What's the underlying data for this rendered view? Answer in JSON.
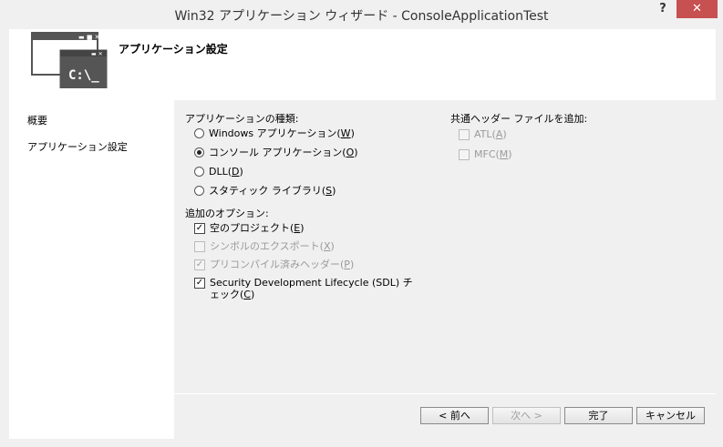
{
  "window": {
    "title": "Win32 アプリケーション ウィザード - ConsoleApplicationTest",
    "help_label": "?",
    "close_label": "✕"
  },
  "header": {
    "title": "アプリケーション設定",
    "logo_text": "C:\\_"
  },
  "nav": {
    "items": [
      {
        "label": "概要"
      },
      {
        "label": "アプリケーション設定"
      }
    ]
  },
  "app_type": {
    "label": "アプリケーションの種類:",
    "options": [
      {
        "label": "Windows アプリケーション(",
        "key": "W",
        "selected": false
      },
      {
        "label": "コンソール アプリケーション(",
        "key": "O",
        "selected": true
      },
      {
        "label": "DLL(",
        "key": "D",
        "selected": false
      },
      {
        "label": "スタティック ライブラリ(",
        "key": "S",
        "selected": false
      }
    ]
  },
  "additional": {
    "label": "追加のオプション:",
    "options": [
      {
        "label": "空のプロジェクト(",
        "key": "E",
        "checked": true,
        "enabled": true
      },
      {
        "label": "シンボルのエクスポート(",
        "key": "X",
        "checked": false,
        "enabled": false
      },
      {
        "label": "プリコンパイル済みヘッダー(",
        "key": "P",
        "checked": true,
        "enabled": false
      },
      {
        "label": "Security Development Lifecycle (SDL) チェック(",
        "key": "C",
        "checked": true,
        "enabled": true
      }
    ]
  },
  "common_headers": {
    "label": "共通ヘッダー ファイルを追加:",
    "options": [
      {
        "label": "ATL(",
        "key": "A",
        "checked": false,
        "enabled": false
      },
      {
        "label": "MFC(",
        "key": "M",
        "checked": false,
        "enabled": false
      }
    ]
  },
  "buttons": {
    "prev": "< 前へ",
    "next": "次へ >",
    "finish": "完了",
    "cancel": "キャンセル"
  },
  "colors": {
    "close_button": "#c75050",
    "logo_dark": "#555555"
  }
}
